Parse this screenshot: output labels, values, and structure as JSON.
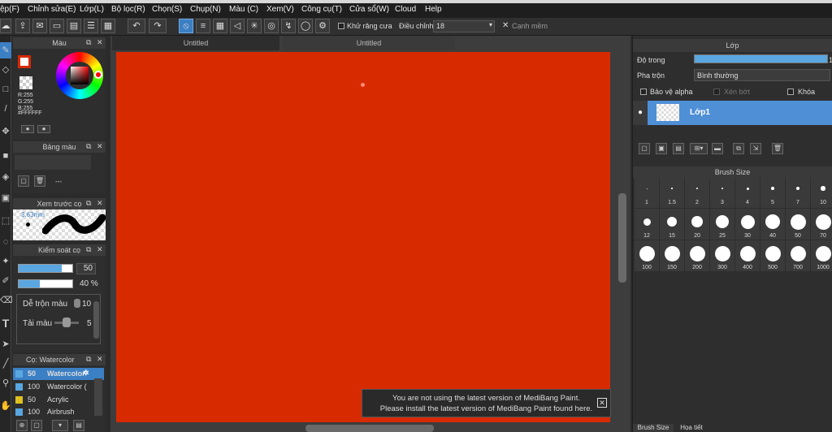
{
  "menu": [
    "ệp(F)",
    "Chỉnh sửa(E)",
    "Lớp(L)",
    "Bộ lọc(R)",
    "Chọn(S)",
    "Chụp(N)",
    "Màu (C)",
    "Xem(V)",
    "Công cụ(T)",
    "Cửa sổ(W)",
    "Cloud",
    "Help"
  ],
  "toolbar": {
    "antialias": "Khử răng cưa",
    "adjust_label": "Điều chỉnh",
    "adjust_value": "18",
    "soft_edge": "Cạnh mềm"
  },
  "color_panel": {
    "title": "Màu",
    "r": "R:255",
    "g": "G:255",
    "b": "B:255",
    "hex": "#FFFFFF"
  },
  "palette_panel": {
    "title": "Bảng màu",
    "value": "---"
  },
  "preview_panel": {
    "title": "Xem trước cọ",
    "size": "3.63mm"
  },
  "brush_control": {
    "title": "Kiểm soát cọ",
    "size": "50",
    "opacity": "40 %",
    "blend_label": "Dễ trộn màu",
    "blend_value": "10",
    "reload_label": "Tải màu",
    "reload_value": "5",
    "size_fraction": 0.8,
    "opacity_fraction": 0.4
  },
  "brush_panel": {
    "title": "Cọ: Watercolor",
    "items": [
      {
        "size": "50",
        "name": "Watercolor",
        "color": "#5aa6e0"
      },
      {
        "size": "100",
        "name": "Watercolor (",
        "color": "#5aa6e0"
      },
      {
        "size": "50",
        "name": "Acrylic",
        "color": "#e0c020"
      },
      {
        "size": "100",
        "name": "Airbrush",
        "color": "#5aa6e0"
      }
    ]
  },
  "tabs": [
    "Untitled",
    "Untitled"
  ],
  "notice": {
    "line1": "You are not using the latest version of MediBang Paint.",
    "line2": "Please install the latest version of MediBang Paint found here."
  },
  "layer_panel": {
    "title": "Lớp",
    "opacity_label": "Độ trong",
    "opacity_value": "1",
    "blend_label": "Pha trộn",
    "blend_value": "Bình thường",
    "protect_alpha": "Bảo vệ alpha",
    "clipping": "Xén bớt",
    "lock": "Khóa",
    "layer_name": "Lớp1",
    "opacity_fraction": 1.0
  },
  "brush_size": {
    "title": "Brush Size",
    "sizes": [
      "1",
      "1.5",
      "2",
      "3",
      "4",
      "5",
      "7",
      "10",
      "12",
      "15",
      "20",
      "25",
      "30",
      "40",
      "50",
      "70",
      "100",
      "150",
      "200",
      "300",
      "400",
      "500",
      "700",
      "1000"
    ]
  },
  "bottom_tabs": [
    "Brush Size",
    "Họa tiết"
  ]
}
